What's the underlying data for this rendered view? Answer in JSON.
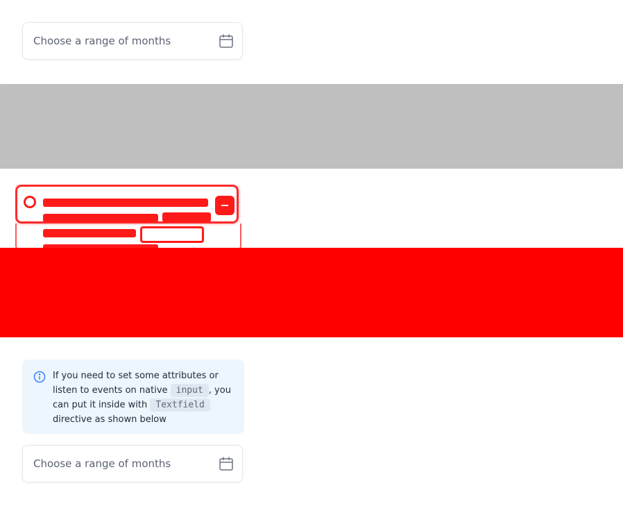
{
  "top_picker": {
    "placeholder": "Choose a range of months",
    "icon": "calendar-icon"
  },
  "info_callout": {
    "icon": "info-icon",
    "text_before_input": "If you need to set some attributes or listen to events on native ",
    "code_input": "input",
    "text_middle": ", you can put it inside with ",
    "code_textfield": "Textfield",
    "text_after": " directive as shown below"
  },
  "bottom_picker": {
    "placeholder": "Choose a range of months",
    "icon": "calendar-icon"
  },
  "colors": {
    "accent_info_bg": "#edf5fd",
    "info_icon": "#3b82f6",
    "gray_band": "#bfbfbf",
    "red_band": "#ff0000"
  }
}
